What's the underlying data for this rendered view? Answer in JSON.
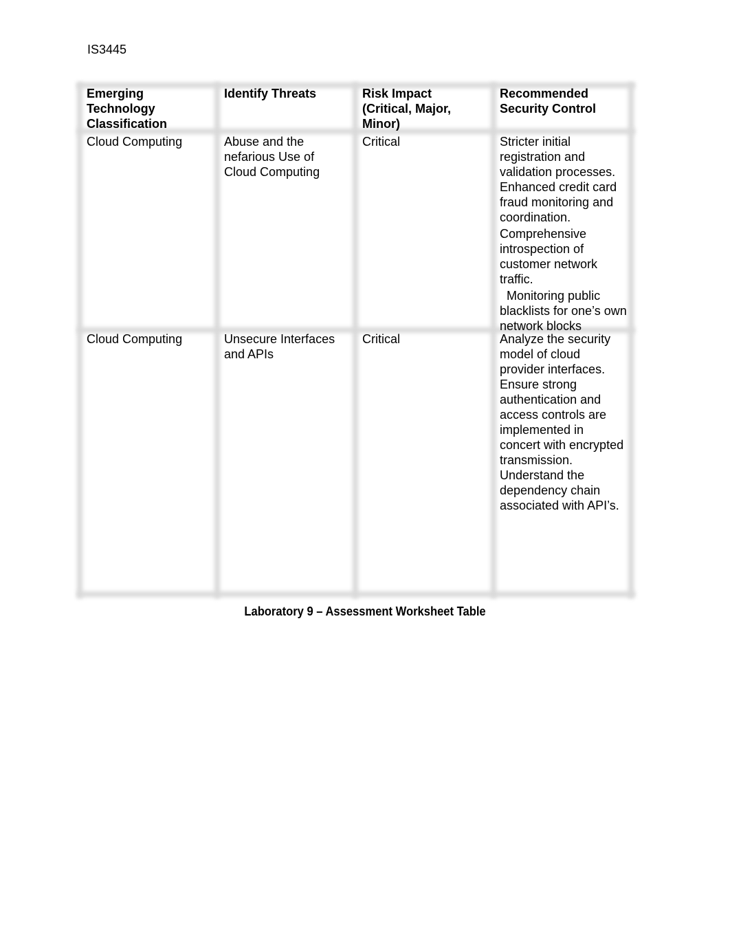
{
  "document": {
    "header_code": "IS3445",
    "caption": "Laboratory 9 – Assessment Worksheet Table"
  },
  "table": {
    "columns": [
      "Emerging Technology Classification",
      "Identify Threats",
      "Risk Impact (Critical, Major, Minor)",
      "Recommended Security Control"
    ],
    "rows": [
      {
        "classification": "Cloud Computing",
        "threat": "Abuse and the nefarious Use of Cloud Computing",
        "risk_impact": "Critical",
        "controls": [
          "Stricter initial registration and validation processes. Enhanced credit card fraud monitoring and coordination.",
          "Comprehensive introspection of customer network traffic.",
          "  Monitoring public blacklists for one’s own network blocks"
        ]
      },
      {
        "classification": "Cloud Computing",
        "threat": "Unsecure Interfaces and APIs",
        "risk_impact": "Critical",
        "controls": [
          "Analyze the security model of cloud provider interfaces. Ensure strong authentication and access controls are implemented in concert with encrypted transmission. Understand the dependency chain associated with API’s."
        ]
      }
    ]
  }
}
